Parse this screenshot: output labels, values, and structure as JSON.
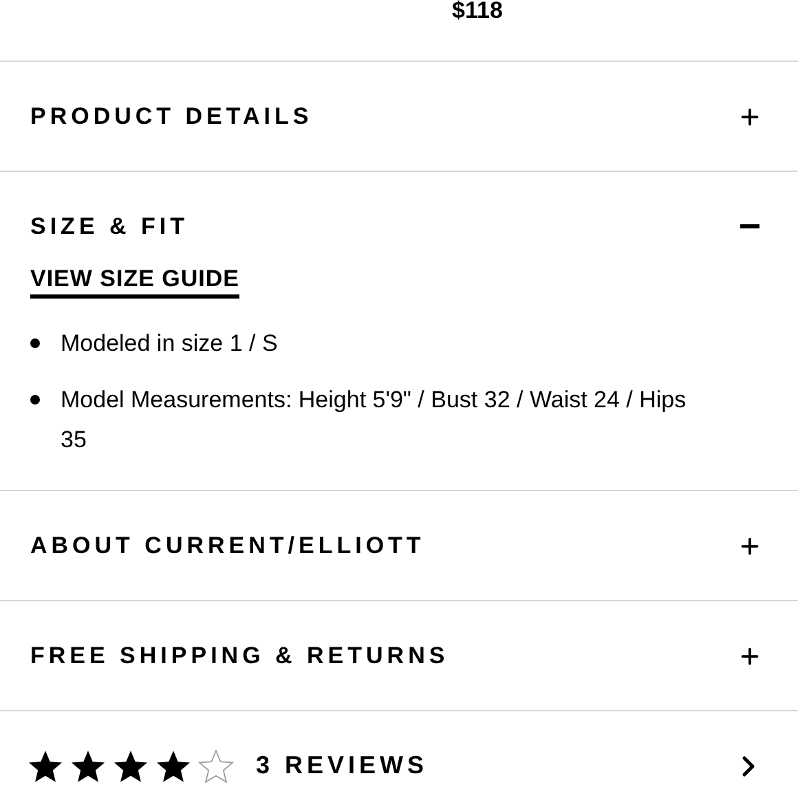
{
  "price": "$118",
  "sections": [
    {
      "title": "PRODUCT DETAILS",
      "expanded": false
    },
    {
      "title": "SIZE & FIT",
      "expanded": true,
      "link": "VIEW SIZE GUIDE",
      "bullets": [
        "Modeled in size 1 / S",
        "Model Measurements: Height 5'9\" / Bust 32 / Waist 24 / Hips 35"
      ]
    },
    {
      "title": "ABOUT CURRENT/ELLIOTT",
      "expanded": false
    },
    {
      "title": "FREE SHIPPING & RETURNS",
      "expanded": false
    }
  ],
  "reviews": {
    "stars": 4,
    "label": "3 REVIEWS"
  }
}
